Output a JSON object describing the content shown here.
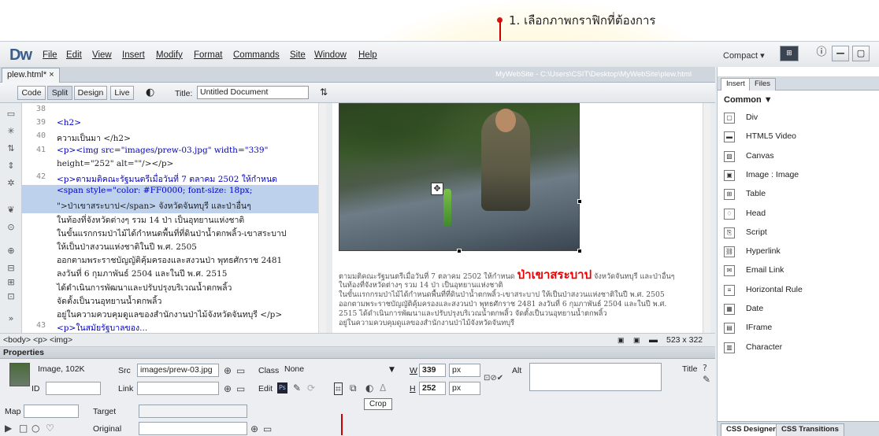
{
  "annotation": {
    "text": "1. เลือกภาพกราฟิกที่ต้องการ"
  },
  "app": {
    "logo": "Dw",
    "menus": [
      "File",
      "Edit",
      "View",
      "Insert",
      "Modify",
      "Format",
      "Commands",
      "Site",
      "Window",
      "Help"
    ],
    "workspace": "Compact",
    "workspace_caret": "▾"
  },
  "document": {
    "tab": "plew.html* ×",
    "path": "MyWebSite - C:\\Users\\CSIT\\Desktop\\MyWebSite\\plew.html",
    "views": [
      "Code",
      "Split",
      "Design",
      "Live"
    ],
    "title_label": "Title:",
    "title_value": "Untitled Document"
  },
  "code": {
    "lines": [
      {
        "n": "38",
        "t": ""
      },
      {
        "n": "39",
        "t": "<h2>"
      },
      {
        "n": "40",
        "t": "ความเป็นมา </h2>"
      },
      {
        "n": "41",
        "t": "<p><img src=\"images/prew-03.jpg\" width=\"339\""
      },
      {
        "n": "",
        "t": "height=\"252\"  alt=\"\"/></p>"
      },
      {
        "n": "42",
        "t": "<p>ตามมติคณะรัฐมนตรีเมื่อวันที่ 7 ตลาคม 2502 ให้กำหนด"
      },
      {
        "n": "",
        "t": "<span style=\"color: #FF0000; font-size: 18px;"
      },
      {
        "n": "",
        "t": "\">ป่าเขาสระบาป</span> จังหวัดจันทบุรี และป่าอื่นๆ"
      },
      {
        "n": "",
        "t": "ในท้องที่จังหวัดต่างๆ รวม 14 ป่า เป็นอุทยานแห่งชาติ"
      },
      {
        "n": "",
        "t": "ในขั้นแรกกรมป่าไม้ได้กำหนดพื้นที่ที่ดินป่าน้ำตกพลิ้ว-เขาสระบาป"
      },
      {
        "n": "",
        "t": "ให้เป็นป่าสงวนแห่งชาติในปี พ.ศ. 2505"
      },
      {
        "n": "",
        "t": "ออกตามพระราชบัญญัติคุ้มครองและสงวนป่า พุทธศักราช 2481"
      },
      {
        "n": "",
        "t": "ลงวันที่ 6 กุมภาพันธ์ 2504 และในปี พ.ศ. 2515"
      },
      {
        "n": "",
        "t": "ได้ดำเนินการพัฒนาและปรับปรุงบริเวณน้ำตกพลิ้ว"
      },
      {
        "n": "",
        "t": "จัดตั้งเป็นวนอุทยานน้ำตกพลิ้ว"
      },
      {
        "n": "",
        "t": "อยู่ในความควบคุมดูแลของสำนักงานป่าไม้จังหวัดจันทบุรี </p>"
      },
      {
        "n": "43",
        "t": "<p>ในสมัยรัฐบาลของ..."
      }
    ]
  },
  "design": {
    "para1": "ตามมติคณะรัฐมนตรีเมื่อวันที่ 7 ตลาคม 2502 ให้กำหนด",
    "highlight": "ป่าเขาสระบาป",
    "para1_end": "จังหวัดจันทบุรี และป่าอื่นๆ",
    "lines": [
      "ในท้องที่จังหวัดต่างๆ รวม 14 ป่า เป็นอุทยานแห่งชาติ",
      "ในขั้นแรกกรมป่าไม้ได้กำหนดพื้นที่ที่ดินป่าน้ำตกพลิ้ว-เขาสระบาป ให้เป็นป่าสงวนแห่งชาติในปี พ.ศ. 2505",
      "ออกตามพระราชบัญญัติคุ้มครองและสงวนป่า พุทธศักราช 2481 ลงวันที่ 6 กุมภาพันธ์ 2504 และในปี พ.ศ.",
      "2515 ได้ดำเนินการพัฒนาและปรับปรุงบริเวณน้ำตกพลิ้ว จัดตั้งเป็นวนอุทยานน้ำตกพลิ้ว",
      "อยู่ในความควบคุมดูแลของสำนักงานป่าไม้จังหวัดจันทบุรี"
    ]
  },
  "status": {
    "tags": "<body> <p> <img>",
    "size": "523 x 322"
  },
  "properties": {
    "header": "Properties",
    "image_info": "Image, 102K",
    "id_label": "ID",
    "src_label": "Src",
    "src_value": "images/prew-03.jpg",
    "link_label": "Link",
    "class_label": "Class",
    "class_value": "None",
    "edit_label": "Edit",
    "w_label": "W",
    "w_value": "339",
    "h_label": "H",
    "h_value": "252",
    "unit": "px",
    "alt_label": "Alt",
    "title_label": "Title",
    "map_label": "Map",
    "target_label": "Target",
    "original_label": "Original",
    "tooltip": "Crop"
  },
  "panel": {
    "tabs": [
      "Insert",
      "Files"
    ],
    "category": "Common ▼",
    "items": [
      "Div",
      "HTML5 Video",
      "Canvas",
      "Image : Image",
      "Table",
      "Head",
      "Script",
      "Hyperlink",
      "Email Link",
      "Horizontal Rule",
      "Date",
      "IFrame",
      "Character"
    ],
    "bottom_tabs": [
      "CSS Designer",
      "CSS Transitions"
    ]
  },
  "colors": {
    "accent_red": "#cc0000",
    "selection": "#bdd0ec",
    "code_tag": "#0000c8"
  }
}
